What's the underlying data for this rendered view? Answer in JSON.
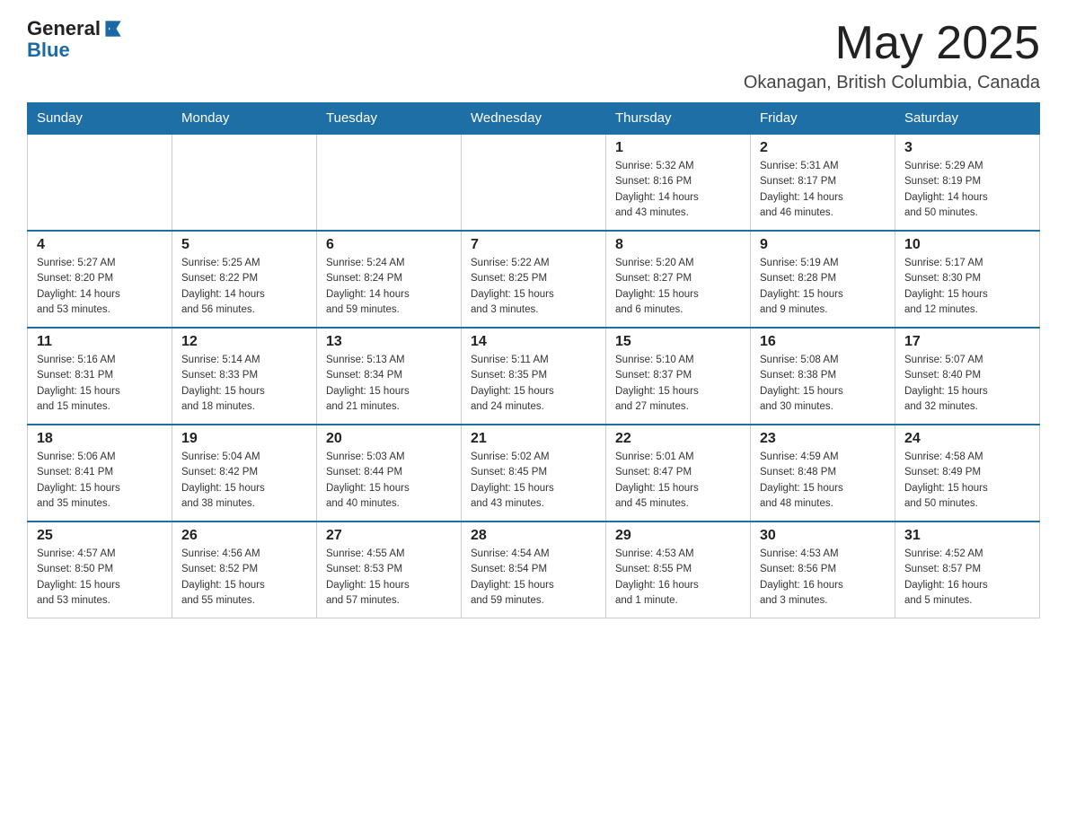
{
  "header": {
    "logo_general": "General",
    "logo_blue": "Blue",
    "month_title": "May 2025",
    "location": "Okanagan, British Columbia, Canada"
  },
  "days_of_week": [
    "Sunday",
    "Monday",
    "Tuesday",
    "Wednesday",
    "Thursday",
    "Friday",
    "Saturday"
  ],
  "weeks": [
    [
      {
        "day": "",
        "info": ""
      },
      {
        "day": "",
        "info": ""
      },
      {
        "day": "",
        "info": ""
      },
      {
        "day": "",
        "info": ""
      },
      {
        "day": "1",
        "info": "Sunrise: 5:32 AM\nSunset: 8:16 PM\nDaylight: 14 hours\nand 43 minutes."
      },
      {
        "day": "2",
        "info": "Sunrise: 5:31 AM\nSunset: 8:17 PM\nDaylight: 14 hours\nand 46 minutes."
      },
      {
        "day": "3",
        "info": "Sunrise: 5:29 AM\nSunset: 8:19 PM\nDaylight: 14 hours\nand 50 minutes."
      }
    ],
    [
      {
        "day": "4",
        "info": "Sunrise: 5:27 AM\nSunset: 8:20 PM\nDaylight: 14 hours\nand 53 minutes."
      },
      {
        "day": "5",
        "info": "Sunrise: 5:25 AM\nSunset: 8:22 PM\nDaylight: 14 hours\nand 56 minutes."
      },
      {
        "day": "6",
        "info": "Sunrise: 5:24 AM\nSunset: 8:24 PM\nDaylight: 14 hours\nand 59 minutes."
      },
      {
        "day": "7",
        "info": "Sunrise: 5:22 AM\nSunset: 8:25 PM\nDaylight: 15 hours\nand 3 minutes."
      },
      {
        "day": "8",
        "info": "Sunrise: 5:20 AM\nSunset: 8:27 PM\nDaylight: 15 hours\nand 6 minutes."
      },
      {
        "day": "9",
        "info": "Sunrise: 5:19 AM\nSunset: 8:28 PM\nDaylight: 15 hours\nand 9 minutes."
      },
      {
        "day": "10",
        "info": "Sunrise: 5:17 AM\nSunset: 8:30 PM\nDaylight: 15 hours\nand 12 minutes."
      }
    ],
    [
      {
        "day": "11",
        "info": "Sunrise: 5:16 AM\nSunset: 8:31 PM\nDaylight: 15 hours\nand 15 minutes."
      },
      {
        "day": "12",
        "info": "Sunrise: 5:14 AM\nSunset: 8:33 PM\nDaylight: 15 hours\nand 18 minutes."
      },
      {
        "day": "13",
        "info": "Sunrise: 5:13 AM\nSunset: 8:34 PM\nDaylight: 15 hours\nand 21 minutes."
      },
      {
        "day": "14",
        "info": "Sunrise: 5:11 AM\nSunset: 8:35 PM\nDaylight: 15 hours\nand 24 minutes."
      },
      {
        "day": "15",
        "info": "Sunrise: 5:10 AM\nSunset: 8:37 PM\nDaylight: 15 hours\nand 27 minutes."
      },
      {
        "day": "16",
        "info": "Sunrise: 5:08 AM\nSunset: 8:38 PM\nDaylight: 15 hours\nand 30 minutes."
      },
      {
        "day": "17",
        "info": "Sunrise: 5:07 AM\nSunset: 8:40 PM\nDaylight: 15 hours\nand 32 minutes."
      }
    ],
    [
      {
        "day": "18",
        "info": "Sunrise: 5:06 AM\nSunset: 8:41 PM\nDaylight: 15 hours\nand 35 minutes."
      },
      {
        "day": "19",
        "info": "Sunrise: 5:04 AM\nSunset: 8:42 PM\nDaylight: 15 hours\nand 38 minutes."
      },
      {
        "day": "20",
        "info": "Sunrise: 5:03 AM\nSunset: 8:44 PM\nDaylight: 15 hours\nand 40 minutes."
      },
      {
        "day": "21",
        "info": "Sunrise: 5:02 AM\nSunset: 8:45 PM\nDaylight: 15 hours\nand 43 minutes."
      },
      {
        "day": "22",
        "info": "Sunrise: 5:01 AM\nSunset: 8:47 PM\nDaylight: 15 hours\nand 45 minutes."
      },
      {
        "day": "23",
        "info": "Sunrise: 4:59 AM\nSunset: 8:48 PM\nDaylight: 15 hours\nand 48 minutes."
      },
      {
        "day": "24",
        "info": "Sunrise: 4:58 AM\nSunset: 8:49 PM\nDaylight: 15 hours\nand 50 minutes."
      }
    ],
    [
      {
        "day": "25",
        "info": "Sunrise: 4:57 AM\nSunset: 8:50 PM\nDaylight: 15 hours\nand 53 minutes."
      },
      {
        "day": "26",
        "info": "Sunrise: 4:56 AM\nSunset: 8:52 PM\nDaylight: 15 hours\nand 55 minutes."
      },
      {
        "day": "27",
        "info": "Sunrise: 4:55 AM\nSunset: 8:53 PM\nDaylight: 15 hours\nand 57 minutes."
      },
      {
        "day": "28",
        "info": "Sunrise: 4:54 AM\nSunset: 8:54 PM\nDaylight: 15 hours\nand 59 minutes."
      },
      {
        "day": "29",
        "info": "Sunrise: 4:53 AM\nSunset: 8:55 PM\nDaylight: 16 hours\nand 1 minute."
      },
      {
        "day": "30",
        "info": "Sunrise: 4:53 AM\nSunset: 8:56 PM\nDaylight: 16 hours\nand 3 minutes."
      },
      {
        "day": "31",
        "info": "Sunrise: 4:52 AM\nSunset: 8:57 PM\nDaylight: 16 hours\nand 5 minutes."
      }
    ]
  ]
}
